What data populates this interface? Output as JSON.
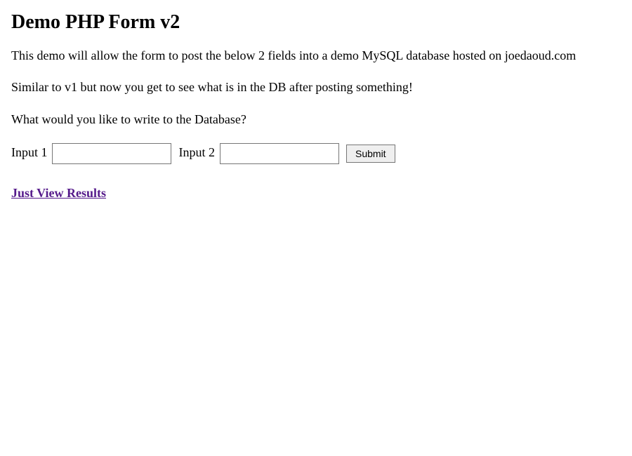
{
  "heading": "Demo PHP Form v2",
  "paragraphs": {
    "p1": "This demo will allow the form to post the below 2 fields into a demo MySQL database hosted on joedaoud.com",
    "p2": "Similar to v1 but now you get to see what is in the DB after posting something!",
    "p3": "What would you like to write to the Database?"
  },
  "form": {
    "label1": "Input 1",
    "input1_value": "",
    "label2": "Input 2",
    "input2_value": "",
    "submit_label": "Submit"
  },
  "link": {
    "text": "Just View Results"
  }
}
